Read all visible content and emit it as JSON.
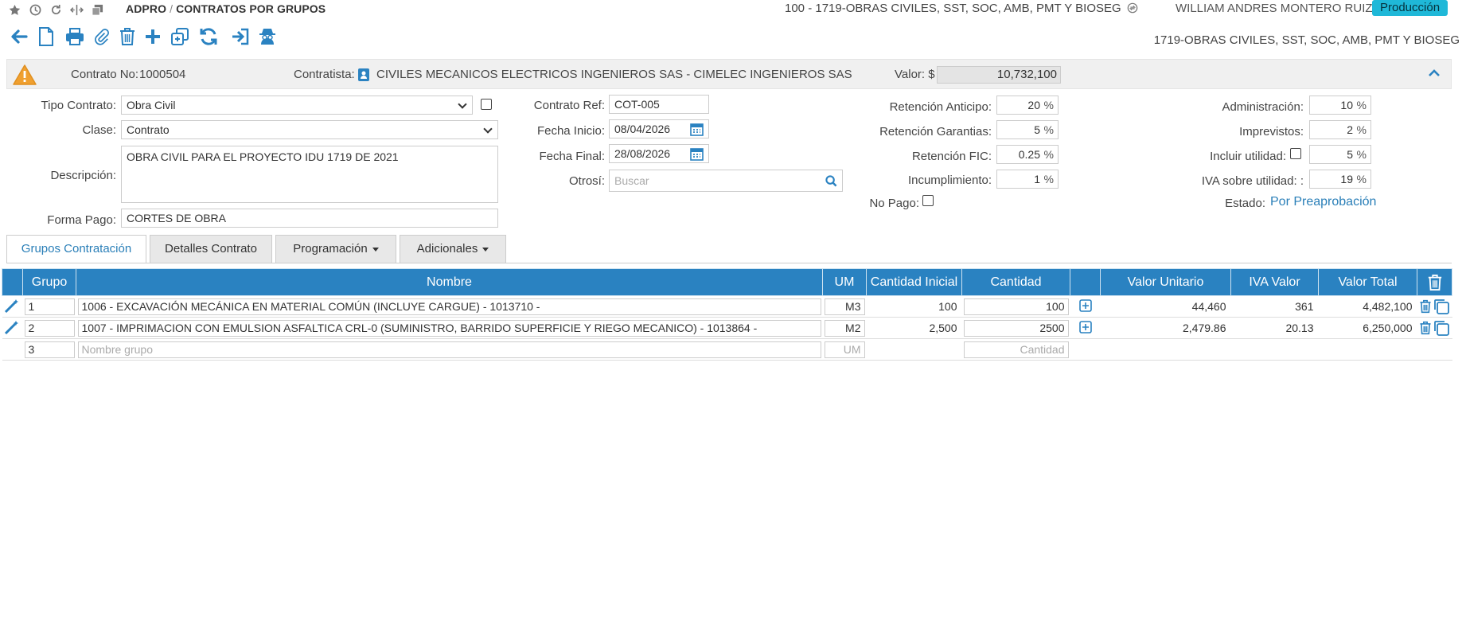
{
  "breadcrumb": {
    "root": "ADPRO",
    "separator": "/",
    "current": "CONTRATOS POR GRUPOS"
  },
  "header": {
    "project": "100 - 1719-OBRAS CIVILES, SST, SOC, AMB, PMT Y BIOSEG",
    "user": "WILLIAM ANDRES MONTERO RUIZ",
    "environment": "Producción"
  },
  "toolbar": {
    "project_label": "1719-OBRAS CIVILES, SST, SOC, AMB, PMT Y BIOSEG"
  },
  "summary": {
    "contract_label": "Contrato No:",
    "contract_no": "1000504",
    "contractor_label": "Contratista:",
    "contractor": "CIVILES MECANICOS ELECTRICOS INGENIEROS SAS - CIMELEC INGENIEROS SAS",
    "value_label": "Valor: $",
    "value": "10,732,100"
  },
  "form": {
    "tipo_label": "Tipo Contrato:",
    "tipo": "Obra Civil",
    "clase_label": "Clase:",
    "clase": "Contrato",
    "descripcion_label": "Descripción:",
    "descripcion": "OBRA CIVIL PARA EL PROYECTO IDU 1719 DE 2021",
    "forma_pago_label": "Forma Pago:",
    "forma_pago": "CORTES DE OBRA",
    "contrato_ref_label": "Contrato Ref:",
    "contrato_ref": "COT-005",
    "fecha_inicio_label": "Fecha Inicio:",
    "fecha_inicio": "08/04/2026",
    "fecha_final_label": "Fecha Final:",
    "fecha_final": "28/08/2026",
    "otrosi_label": "Otrosí:",
    "otrosi_placeholder": "Buscar",
    "ret_anticipo_label": "Retención Anticipo:",
    "ret_anticipo": "20",
    "ret_garantias_label": "Retención Garantias:",
    "ret_garantias": "5",
    "ret_fic_label": "Retención FIC:",
    "ret_fic": "0.25",
    "incumplimiento_label": "Incumplimiento:",
    "incumplimiento": "1",
    "no_pago_label": "No Pago:",
    "administracion_label": "Administración:",
    "administracion": "10",
    "imprevistos_label": "Imprevistos:",
    "imprevistos": "2",
    "incluir_utilidad_label": "Incluir utilidad:",
    "utilidad": "5",
    "iva_utilidad_label": "IVA sobre utilidad: :",
    "iva_utilidad": "19",
    "estado_label": "Estado:",
    "estado": "Por Preaprobación",
    "percent": "%"
  },
  "tabs": [
    {
      "label": "Grupos Contratación"
    },
    {
      "label": "Detalles Contrato"
    },
    {
      "label": "Programación"
    },
    {
      "label": "Adicionales"
    }
  ],
  "table": {
    "headers": [
      "Grupo",
      "Nombre",
      "UM",
      "Cantidad Inicial",
      "Cantidad",
      "Valor Unitario",
      "IVA Valor",
      "Valor Total"
    ],
    "rows": [
      {
        "grupo": "1",
        "nombre": "1006 - EXCAVACIÓN MECÁNICA EN MATERIAL COMÚN (INCLUYE CARGUE) - 1013710 -",
        "um": "M3",
        "cant_inicial": "100",
        "cantidad": "100",
        "valor_unitario": "44,460",
        "iva": "361",
        "total": "4,482,100"
      },
      {
        "grupo": "2",
        "nombre": "1007 - IMPRIMACION CON EMULSION ASFALTICA CRL-0 (SUMINISTRO, BARRIDO SUPERFICIE Y RIEGO MECANICO) - 1013864 -",
        "um": "M2",
        "cant_inicial": "2,500",
        "cantidad": "2500",
        "valor_unitario": "2,479.86",
        "iva": "20.13",
        "total": "6,250,000"
      }
    ],
    "new_row": {
      "grupo": "3",
      "nombre_placeholder": "Nombre grupo",
      "um_placeholder": "UM",
      "cantidad_placeholder": "Cantidad"
    }
  },
  "colors": {
    "primary": "#2a82c1",
    "badge": "#1fb8d8",
    "warning": "#f0a030",
    "link": "#2a7fb8"
  }
}
